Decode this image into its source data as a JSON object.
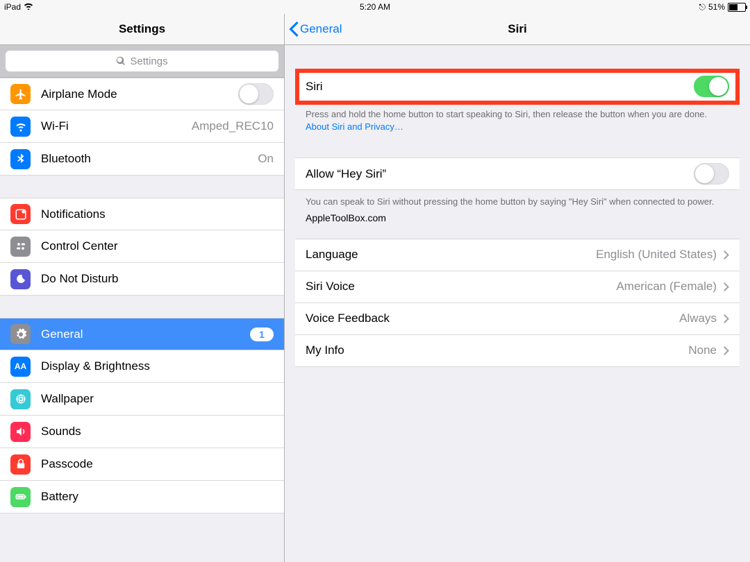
{
  "status": {
    "device": "iPad",
    "time": "5:20 AM",
    "battery": "51%"
  },
  "left": {
    "title": "Settings",
    "search_placeholder": "Settings",
    "groups": [
      [
        {
          "icon": "airplane",
          "color": "#ff9500",
          "label": "Airplane Mode",
          "toggle": false
        },
        {
          "icon": "wifi",
          "color": "#007aff",
          "label": "Wi-Fi",
          "value": "Amped_REC10"
        },
        {
          "icon": "bluetooth",
          "color": "#007aff",
          "label": "Bluetooth",
          "value": "On"
        }
      ],
      [
        {
          "icon": "notifications",
          "color": "#ff3b30",
          "label": "Notifications"
        },
        {
          "icon": "control",
          "color": "#8e8e93",
          "label": "Control Center"
        },
        {
          "icon": "dnd",
          "color": "#5856d6",
          "label": "Do Not Disturb"
        }
      ],
      [
        {
          "icon": "general",
          "color": "#8e8e93",
          "label": "General",
          "badge": "1",
          "selected": true
        },
        {
          "icon": "display",
          "color": "#007aff",
          "label": "Display & Brightness",
          "text": "AA"
        },
        {
          "icon": "wallpaper",
          "color": "#36c9d6",
          "label": "Wallpaper"
        },
        {
          "icon": "sounds",
          "color": "#ff2d55",
          "label": "Sounds"
        },
        {
          "icon": "passcode",
          "color": "#ff3b30",
          "label": "Passcode"
        },
        {
          "icon": "battery",
          "color": "#4cd964",
          "label": "Battery"
        }
      ]
    ]
  },
  "right": {
    "back": "General",
    "title": "Siri",
    "siri_toggle": {
      "label": "Siri",
      "on": true
    },
    "siri_footer_pre": "Press and hold the home button to start speaking to Siri, then release the button when you are done. ",
    "siri_footer_link": "About Siri and Privacy…",
    "hey_siri": {
      "label": "Allow “Hey Siri”",
      "on": false
    },
    "hey_siri_footer": "You can speak to Siri without pressing the home button by saying \"Hey Siri\" when connected to power.",
    "watermark": "AppleToolBox.com",
    "options": [
      {
        "label": "Language",
        "value": "English (United States)"
      },
      {
        "label": "Siri Voice",
        "value": "American (Female)"
      },
      {
        "label": "Voice Feedback",
        "value": "Always"
      },
      {
        "label": "My Info",
        "value": "None"
      }
    ]
  }
}
